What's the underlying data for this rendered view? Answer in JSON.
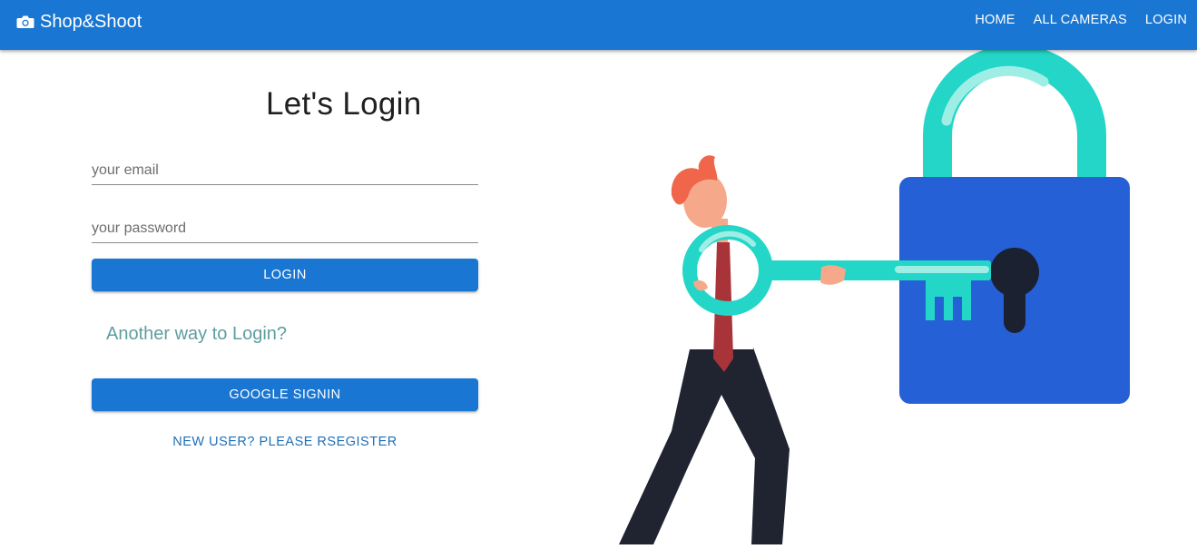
{
  "brand": {
    "name": "Shop&Shoot",
    "icon": "camera-icon"
  },
  "nav": {
    "home": "HOME",
    "all_cameras": "ALL CAMERAS",
    "login": "LOGIN"
  },
  "login": {
    "title": "Let's Login",
    "email_placeholder": "your email",
    "email_value": "",
    "password_placeholder": "your password",
    "password_value": "",
    "login_button": "LOGIN",
    "alt_heading": "Another way to Login?",
    "google_button": "GOOGLE SIGNIN",
    "register_link": "NEW USER? PLEASE RSEGISTER"
  },
  "illustration": {
    "subject": "person-with-key-and-padlock"
  },
  "colors": {
    "primary": "#1976d2",
    "accent_teal": "#24d6c8",
    "lock_body": "#2560d6",
    "alt_heading": "#5f9ea0",
    "register_link": "#1f6fb5"
  }
}
